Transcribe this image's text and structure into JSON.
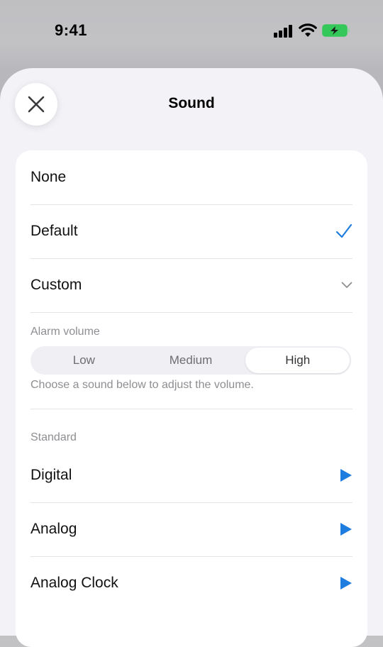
{
  "status_bar": {
    "time": "9:41",
    "battery_color": "#34c759"
  },
  "sheet": {
    "title": "Sound"
  },
  "options": [
    {
      "label": "None",
      "accessory": "none"
    },
    {
      "label": "Default",
      "accessory": "checkmark-icon"
    },
    {
      "label": "Custom",
      "accessory": "chevron-down-icon"
    }
  ],
  "alarm_volume": {
    "label": "Alarm volume",
    "segments": [
      "Low",
      "Medium",
      "High"
    ],
    "selected": "High",
    "hint": "Choose a sound below to adjust the volume."
  },
  "standard": {
    "label": "Standard",
    "sounds": [
      {
        "label": "Digital",
        "icon": "play-icon"
      },
      {
        "label": "Analog",
        "icon": "play-icon"
      },
      {
        "label": "Analog Clock",
        "icon": "play-icon"
      }
    ]
  },
  "colors": {
    "accent": "#1f7de0",
    "sheet_background": "#f2f2f7",
    "secondary_text": "#8e8e93"
  }
}
